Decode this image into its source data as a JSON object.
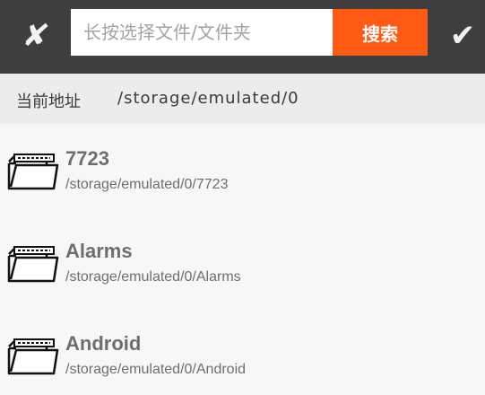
{
  "toolbar": {
    "close_icon": "x-icon",
    "close_glyph": "✘",
    "search_placeholder": "长按选择文件/文件夹",
    "search_value": "",
    "search_button_label": "搜索",
    "confirm_icon": "check-icon",
    "confirm_glyph": "✔"
  },
  "path_bar": {
    "label": "当前地址",
    "value": "/storage/emulated/0"
  },
  "files": [
    {
      "name": "7723",
      "path": "/storage/emulated/0/7723",
      "icon": "folder-icon"
    },
    {
      "name": "Alarms",
      "path": "/storage/emulated/0/Alarms",
      "icon": "folder-icon"
    },
    {
      "name": "Android",
      "path": "/storage/emulated/0/Android",
      "icon": "folder-icon"
    }
  ],
  "colors": {
    "toolbar_bg": "#3f3f3f",
    "accent": "#ff5a14",
    "path_bar_bg": "#ececec",
    "list_bg": "#f7f7f7",
    "text_gray": "#6e6e6e"
  }
}
